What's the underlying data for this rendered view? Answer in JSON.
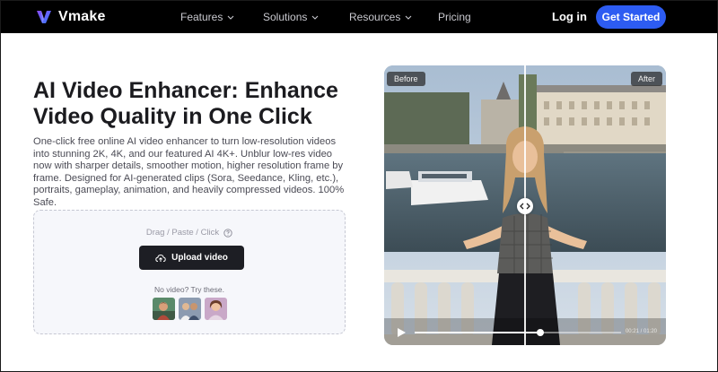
{
  "nav": {
    "brand": "Vmake",
    "items": [
      {
        "label": "Features",
        "has_dropdown": true
      },
      {
        "label": "Solutions",
        "has_dropdown": true
      },
      {
        "label": "Resources",
        "has_dropdown": true
      },
      {
        "label": "Pricing",
        "has_dropdown": false
      }
    ],
    "login": "Log in",
    "cta": "Get Started"
  },
  "hero": {
    "title": "AI Video Enhancer: Enhance Video Quality in One Click",
    "description": "One-click free online AI video enhancer to turn low-resolution videos into stunning 2K, 4K, and our featured AI 4K+. Unblur low-res video now with sharper details, smoother motion, higher resolution frame by frame. Designed for AI-generated clips (Sora, Seedance, Kling, etc.), portraits, gameplay, animation, and heavily compressed videos. 100% Safe."
  },
  "upload": {
    "hint": "Drag / Paste / Click",
    "button": "Upload video",
    "no_video": "No video? Try these.",
    "samples": [
      "sample-video-1",
      "sample-video-2",
      "sample-video-3"
    ]
  },
  "compare": {
    "before_label": "Before",
    "after_label": "After",
    "slider_position": 0.5,
    "progress": 0.61,
    "time": "00:21 / 01:20"
  },
  "colors": {
    "nav_bg": "#000000",
    "cta": "#2d5cf2",
    "upload_button": "#1d1e24"
  },
  "icons": {
    "logo": "vmake-logo-icon",
    "help": "question-circle-icon",
    "upload": "cloud-upload-icon",
    "play": "play-icon",
    "compare": "compare-arrows-icon"
  }
}
